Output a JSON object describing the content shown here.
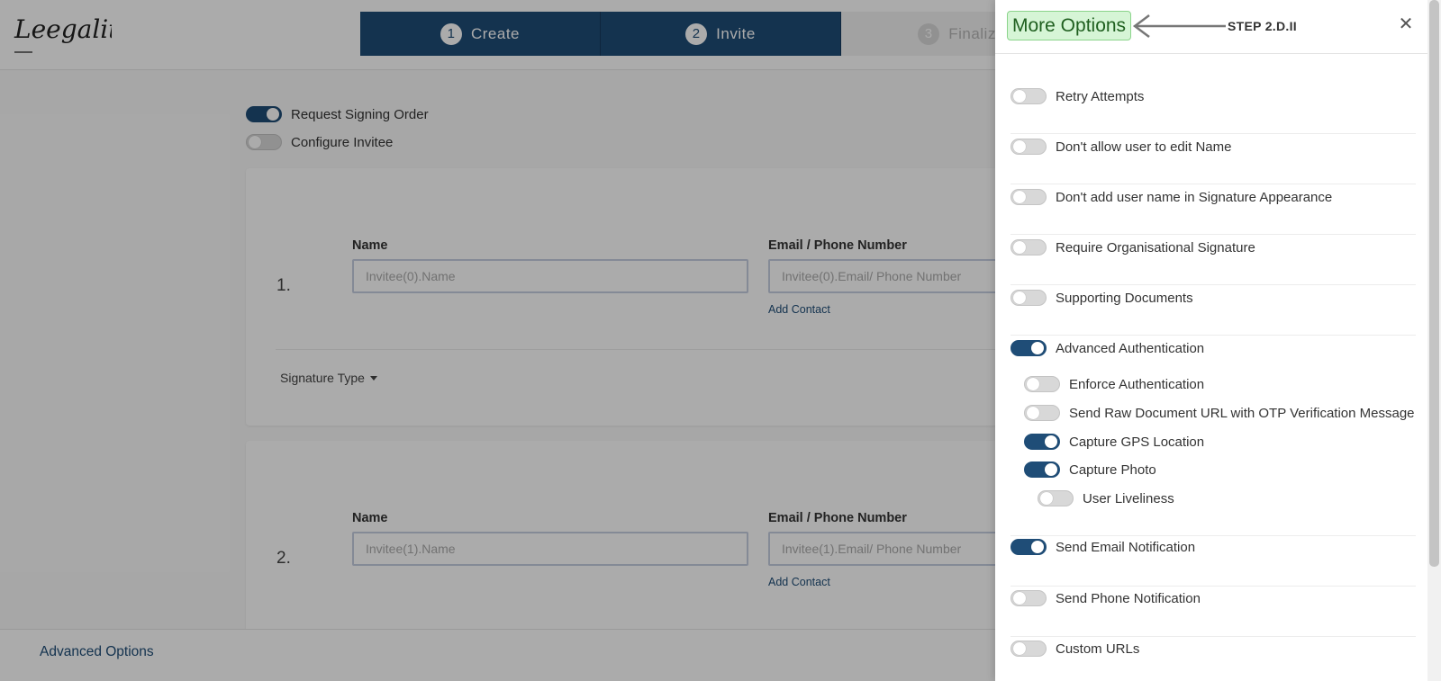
{
  "header": {
    "logo_text": "Leegality",
    "steps": [
      {
        "num": "1",
        "label": "Create"
      },
      {
        "num": "2",
        "label": "Invite"
      },
      {
        "num": "3",
        "label": "Finalize"
      }
    ]
  },
  "options": {
    "request_signing_order": {
      "label": "Request Signing Order",
      "on": true
    },
    "configure_invitee": {
      "label": "Configure Invitee",
      "on": false
    }
  },
  "invitees": [
    {
      "num": "1.",
      "name_label": "Name",
      "name_placeholder": "Invitee(0).Name",
      "contact_label": "Email / Phone Number",
      "contact_placeholder": "Invitee(0).Email/ Phone Number",
      "add_contact": "Add Contact",
      "signature_type": "Signature Type"
    },
    {
      "num": "2.",
      "name_label": "Name",
      "name_placeholder": "Invitee(1).Name",
      "contact_label": "Email / Phone Number",
      "contact_placeholder": "Invitee(1).Email/ Phone Number",
      "add_contact": "Add Contact"
    }
  ],
  "footer": {
    "advanced_options": "Advanced Options"
  },
  "panel": {
    "title": "More Options",
    "annotation": "STEP 2.D.II",
    "items": [
      {
        "label": "Retry Attempts",
        "on": false
      },
      {
        "label": "Don't allow user to edit Name",
        "on": false
      },
      {
        "label": "Don't add user name in Signature Appearance",
        "on": false
      },
      {
        "label": "Require Organisational Signature",
        "on": false
      },
      {
        "label": "Supporting Documents",
        "on": false
      },
      {
        "label": "Advanced Authentication",
        "on": true
      },
      {
        "label": "Enforce Authentication",
        "on": false
      },
      {
        "label": "Send Raw Document URL with OTP Verification Message",
        "on": false
      },
      {
        "label": "Capture GPS Location",
        "on": true
      },
      {
        "label": "Capture Photo",
        "on": true
      },
      {
        "label": "User Liveliness",
        "on": false
      },
      {
        "label": "Send Email Notification",
        "on": true
      },
      {
        "label": "Send Phone Notification",
        "on": false
      },
      {
        "label": "Custom URLs",
        "on": false
      }
    ]
  },
  "colors": {
    "primary": "#1f4d77",
    "annotation_bg": "#d6f5d6"
  }
}
